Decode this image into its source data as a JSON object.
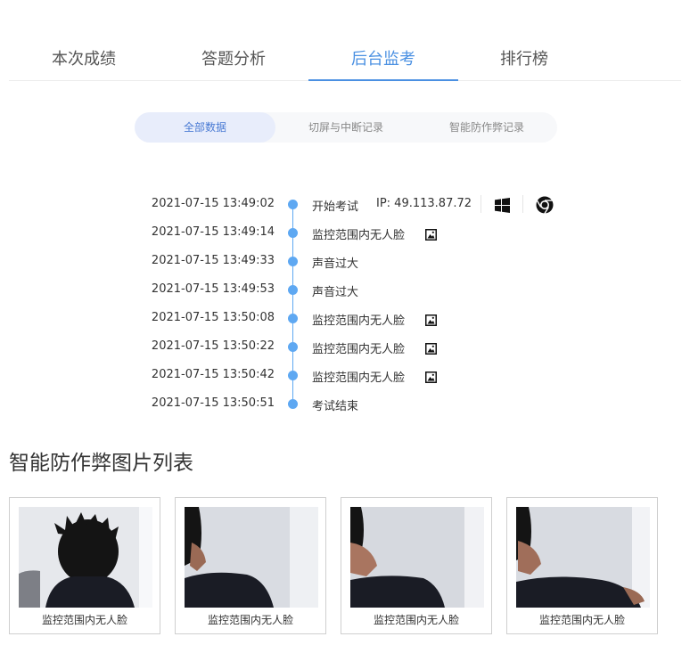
{
  "tabs": [
    {
      "label": "本次成绩",
      "active": false
    },
    {
      "label": "答题分析",
      "active": false
    },
    {
      "label": "后台监考",
      "active": true
    },
    {
      "label": "排行榜",
      "active": false
    }
  ],
  "filters": [
    {
      "label": "全部数据",
      "active": true
    },
    {
      "label": "切屏与中断记录",
      "active": false
    },
    {
      "label": "智能防作弊记录",
      "active": false
    }
  ],
  "timeline": [
    {
      "time": "2021-07-15 13:49:02",
      "event": "开始考试",
      "ip": "IP: 49.113.87.72",
      "icons": [
        "windows-icon",
        "chrome-icon"
      ]
    },
    {
      "time": "2021-07-15 13:49:14",
      "event": "监控范围内无人脸",
      "icons": [
        "image-icon"
      ]
    },
    {
      "time": "2021-07-15 13:49:33",
      "event": "声音过大",
      "icons": []
    },
    {
      "time": "2021-07-15 13:49:53",
      "event": "声音过大",
      "icons": []
    },
    {
      "time": "2021-07-15 13:50:08",
      "event": "监控范围内无人脸",
      "icons": [
        "image-icon"
      ]
    },
    {
      "time": "2021-07-15 13:50:22",
      "event": "监控范围内无人脸",
      "icons": [
        "image-icon"
      ]
    },
    {
      "time": "2021-07-15 13:50:42",
      "event": "监控范围内无人脸",
      "icons": [
        "image-icon"
      ]
    },
    {
      "time": "2021-07-15 13:50:51",
      "event": "考试结束",
      "icons": []
    }
  ],
  "gallery": {
    "title": "智能防作弊图片列表",
    "items": [
      {
        "caption": "监控范围内无人脸"
      },
      {
        "caption": "监控范围内无人脸"
      },
      {
        "caption": "监控范围内无人脸"
      },
      {
        "caption": "监控范围内无人脸"
      }
    ]
  },
  "colors": {
    "accent": "#4a90e2",
    "timeline": "#5ea8f2",
    "filter_active_bg": "#e8edfb"
  }
}
